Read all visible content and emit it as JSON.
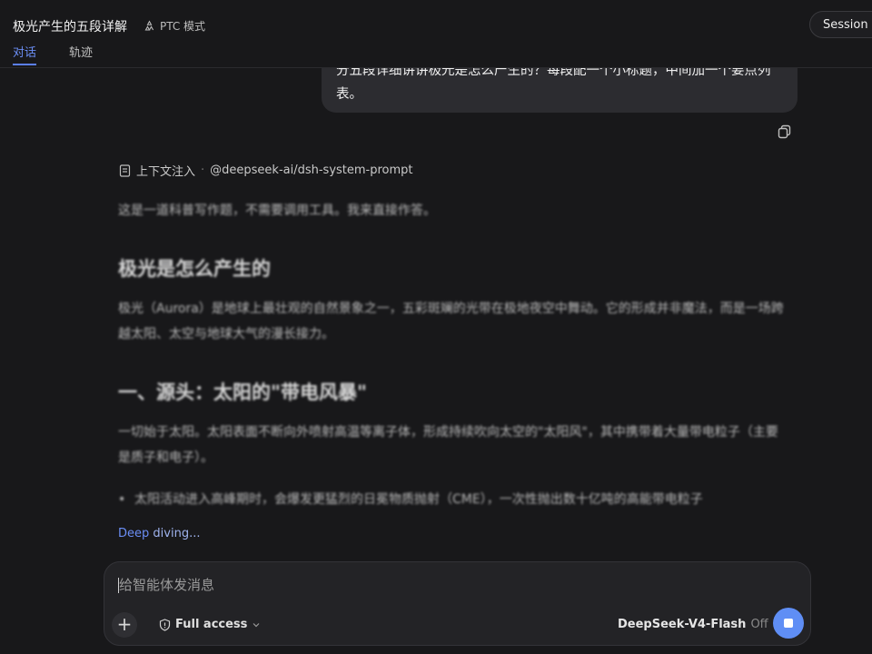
{
  "header": {
    "title": "极光产生的五段详解",
    "mode_label": "PTC 模式",
    "session_button_label": "Session lo",
    "tabs": [
      {
        "label": "对话",
        "active": true
      },
      {
        "label": "轨迹",
        "active": false
      }
    ]
  },
  "conversation": {
    "user_message": "分五段详细讲讲极光是怎么产生的？每段配一个小标题，中间加一个要点列表。",
    "context_injection": {
      "label": "上下文注入",
      "source": "@deepseek-ai/dsh-system-prompt"
    },
    "answer": {
      "intro": "这是一道科普写作题，不需要调用工具。我来直接作答。",
      "heading_1": "极光是怎么产生的",
      "paragraph_1": "极光（Aurora）是地球上最壮观的自然景象之一，五彩斑斓的光带在极地夜空中舞动。它的形成并非魔法，而是一场跨越太阳、太空与地球大气的漫长接力。",
      "heading_2": "一、源头：太阳的\"带电风暴\"",
      "paragraph_2": "一切始于太阳。太阳表面不断向外喷射高温等离子体，形成持续吹向太空的\"太阳风\"，其中携带着大量带电粒子（主要是质子和电子）。",
      "bullet_1": "太阳活动进入高峰期时，会爆发更猛烈的日冕物质抛射（CME），一次性抛出数十亿吨的高能带电粒子"
    },
    "status": {
      "word1": "Deep",
      "word2": "diving..."
    }
  },
  "composer": {
    "placeholder": "给智能体发消息",
    "access_label": "Full access",
    "model_name": "DeepSeek-V4-Flash",
    "model_mode": "Off"
  },
  "colors": {
    "accent": "#5f8ef5",
    "background": "#18181a",
    "bubble": "#2c2c30"
  }
}
